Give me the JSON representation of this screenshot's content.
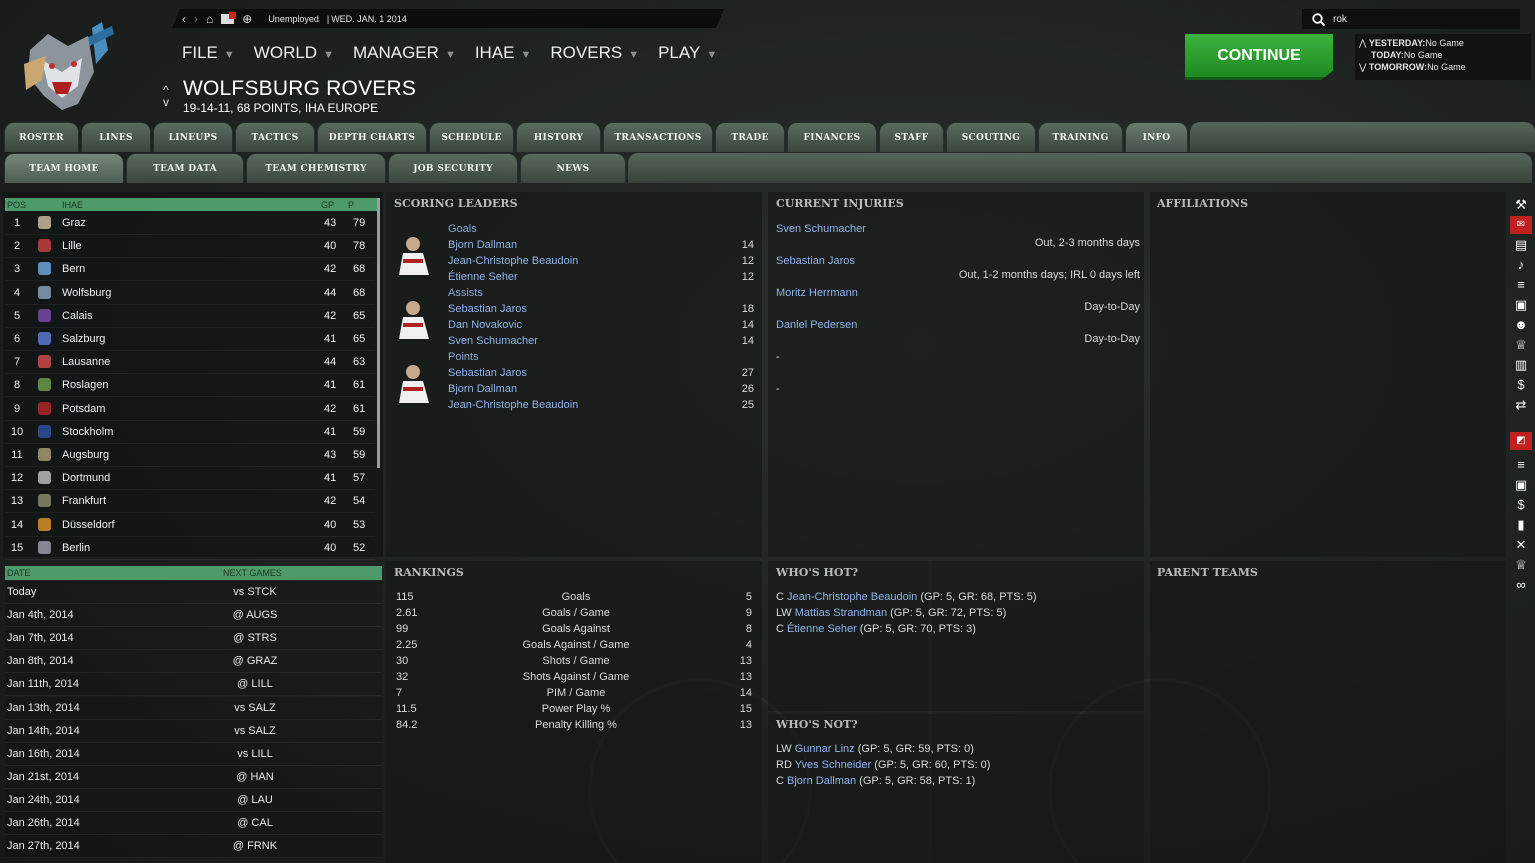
{
  "topbar": {
    "status": "Unemployed",
    "date": "WED. JAN. 1 2014"
  },
  "search": {
    "value": "rok"
  },
  "menu": [
    "FILE",
    "WORLD",
    "MANAGER",
    "IHAE",
    "ROVERS",
    "PLAY"
  ],
  "team": {
    "name": "WOLFSBURG ROVERS",
    "record": "19-14-11, 68 POINTS, IHA EUROPE"
  },
  "continue": "CONTINUE",
  "games": {
    "yesterday_label": "YESTERDAY:",
    "yesterday": "No Game",
    "today_label": "TODAY:",
    "today": "No Game",
    "tomorrow_label": "TOMORROW:",
    "tomorrow": "No Game"
  },
  "tabs_row1": [
    "ROSTER",
    "LINES",
    "LINEUPS",
    "TACTICS",
    "DEPTH CHARTS",
    "SCHEDULE",
    "HISTORY",
    "TRANSACTIONS",
    "TRADE",
    "FINANCES",
    "STAFF",
    "SCOUTING",
    "TRAINING",
    "INFO"
  ],
  "tabs_row2": [
    "TEAM HOME",
    "TEAM DATA",
    "TEAM CHEMISTRY",
    "JOB SECURITY",
    "NEWS"
  ],
  "standings": {
    "headers": {
      "pos": "POS",
      "league": "IHAE",
      "gp": "GP",
      "p": "P"
    },
    "rows": [
      {
        "pos": "1",
        "team": "Graz",
        "gp": "43",
        "p": "79",
        "color": "#c8b89a"
      },
      {
        "pos": "2",
        "team": "Lille",
        "gp": "40",
        "p": "78",
        "color": "#c24040"
      },
      {
        "pos": "3",
        "team": "Bern",
        "gp": "42",
        "p": "68",
        "color": "#6aa6d8"
      },
      {
        "pos": "4",
        "team": "Wolfsburg",
        "gp": "44",
        "p": "68",
        "color": "#8aa0b8"
      },
      {
        "pos": "5",
        "team": "Calais",
        "gp": "42",
        "p": "65",
        "color": "#7a4aa8"
      },
      {
        "pos": "6",
        "team": "Salzburg",
        "gp": "41",
        "p": "65",
        "color": "#5a7ad0"
      },
      {
        "pos": "7",
        "team": "Lausanne",
        "gp": "44",
        "p": "63",
        "color": "#d04a4a"
      },
      {
        "pos": "8",
        "team": "Roslagen",
        "gp": "41",
        "p": "61",
        "color": "#6a9a4a"
      },
      {
        "pos": "9",
        "team": "Potsdam",
        "gp": "42",
        "p": "61",
        "color": "#b02828"
      },
      {
        "pos": "10",
        "team": "Stockholm",
        "gp": "41",
        "p": "59",
        "color": "#3050a0"
      },
      {
        "pos": "11",
        "team": "Augsburg",
        "gp": "43",
        "p": "59",
        "color": "#a89a70"
      },
      {
        "pos": "12",
        "team": "Dortmund",
        "gp": "41",
        "p": "57",
        "color": "#b8b8b8"
      },
      {
        "pos": "13",
        "team": "Frankfurt",
        "gp": "42",
        "p": "54",
        "color": "#8a8a6a"
      },
      {
        "pos": "14",
        "team": "Düsseldorf",
        "gp": "40",
        "p": "53",
        "color": "#d8902a"
      },
      {
        "pos": "15",
        "team": "Berlin",
        "gp": "40",
        "p": "52",
        "color": "#9a9aa8"
      }
    ]
  },
  "next_games": {
    "headers": {
      "date": "DATE",
      "next": "NEXT GAMES"
    },
    "rows": [
      {
        "date": "Today",
        "game": "vs STCK"
      },
      {
        "date": "Jan 4th, 2014",
        "game": "@ AUGS"
      },
      {
        "date": "Jan 7th, 2014",
        "game": "@ STRS"
      },
      {
        "date": "Jan 8th, 2014",
        "game": "@ GRAZ"
      },
      {
        "date": "Jan 11th, 2014",
        "game": "@ LILL"
      },
      {
        "date": "Jan 13th, 2014",
        "game": "vs SALZ"
      },
      {
        "date": "Jan 14th, 2014",
        "game": "vs SALZ"
      },
      {
        "date": "Jan 16th, 2014",
        "game": "vs LILL"
      },
      {
        "date": "Jan 21st, 2014",
        "game": "@ HAN"
      },
      {
        "date": "Jan 24th, 2014",
        "game": "@ LAU"
      },
      {
        "date": "Jan 26th, 2014",
        "game": "@ CAL"
      },
      {
        "date": "Jan 27th, 2014",
        "game": "@ FRNK"
      }
    ]
  },
  "scoring": {
    "title": "SCORING LEADERS",
    "groups": [
      {
        "label": "Goals",
        "players": [
          {
            "name": "Bjorn Dallman",
            "val": "14"
          },
          {
            "name": "Jean-Christophe Beaudoin",
            "val": "12"
          },
          {
            "name": "Étienne Seher",
            "val": "12"
          }
        ]
      },
      {
        "label": "Assists",
        "players": [
          {
            "name": "Sebastian Jaros",
            "val": "18"
          },
          {
            "name": "Dan Novakovic",
            "val": "14"
          },
          {
            "name": "Sven Schumacher",
            "val": "14"
          }
        ]
      },
      {
        "label": "Points",
        "players": [
          {
            "name": "Sebastian Jaros",
            "val": "27"
          },
          {
            "name": "Bjorn Dallman",
            "val": "26"
          },
          {
            "name": "Jean-Christophe Beaudoin",
            "val": "25"
          }
        ]
      }
    ]
  },
  "injuries": {
    "title": "CURRENT INJURIES",
    "rows": [
      {
        "name": "Sven Schumacher",
        "status": "Out, 2-3 months days"
      },
      {
        "name": "Sebastian Jaros",
        "status": "Out, 1-2 months days; IRL 0 days left"
      },
      {
        "name": "Moritz Herrmann",
        "status": "Day-to-Day"
      },
      {
        "name": "Daniel Pedersen",
        "status": "Day-to-Day"
      }
    ],
    "dashes": [
      "-",
      "-"
    ]
  },
  "affiliations": {
    "title": "AFFILIATIONS"
  },
  "parent_teams": {
    "title": "PARENT TEAMS"
  },
  "rankings": {
    "title": "RANKINGS",
    "rows": [
      {
        "value": "115",
        "label": "Goals",
        "rank": "5"
      },
      {
        "value": "2.61",
        "label": "Goals / Game",
        "rank": "9"
      },
      {
        "value": "99",
        "label": "Goals Against",
        "rank": "8"
      },
      {
        "value": "2.25",
        "label": "Goals Against / Game",
        "rank": "4"
      },
      {
        "value": "30",
        "label": "Shots / Game",
        "rank": "13"
      },
      {
        "value": "32",
        "label": "Shots Against / Game",
        "rank": "13"
      },
      {
        "value": "7",
        "label": "PIM / Game",
        "rank": "14"
      },
      {
        "value": "11.5",
        "label": "Power Play %",
        "rank": "15"
      },
      {
        "value": "84.2",
        "label": "Penalty Killing %",
        "rank": "13"
      }
    ]
  },
  "hot": {
    "title": "WHO'S HOT?",
    "rows": [
      {
        "pos": "C",
        "name": "Jean-Christophe Beaudoin",
        "stats": "(GP: 5, GR: 68, PTS: 5)"
      },
      {
        "pos": "LW",
        "name": "Mattias Strandman",
        "stats": "(GP: 5, GR: 72, PTS: 5)"
      },
      {
        "pos": "C",
        "name": "Étienne Seher",
        "stats": "(GP: 5, GR: 70, PTS: 3)"
      }
    ]
  },
  "not": {
    "title": "WHO'S NOT?",
    "rows": [
      {
        "pos": "LW",
        "name": "Gunnar Linz",
        "stats": "(GP: 5, GR: 59, PTS: 0)"
      },
      {
        "pos": "RD",
        "name": "Yves Schneider",
        "stats": "(GP: 5, GR: 60, PTS: 0)"
      },
      {
        "pos": "C",
        "name": "Bjorn Dallman",
        "stats": "(GP: 5, GR: 58, PTS: 1)"
      }
    ]
  },
  "colors": {
    "accent_green": "#2ea535",
    "link": "#8fb2ea",
    "header_green": "#4e9a6a"
  },
  "icons": [
    "back-icon",
    "forward-icon",
    "home-icon",
    "mail-icon",
    "globe-icon",
    "search-icon"
  ],
  "sidebar_icons": [
    "hockey-stick-icon",
    "mail-icon",
    "clipboard-icon",
    "whistle-icon",
    "list-icon",
    "rink-icon",
    "people-icon",
    "trophy-icon",
    "document-icon",
    "money-people-icon",
    "trade-icon",
    "flag-icon",
    "list-icon",
    "rink-icon",
    "dollar-icon",
    "chart-icon",
    "sticks-icon",
    "trophy-icon",
    "binoculars-icon"
  ]
}
